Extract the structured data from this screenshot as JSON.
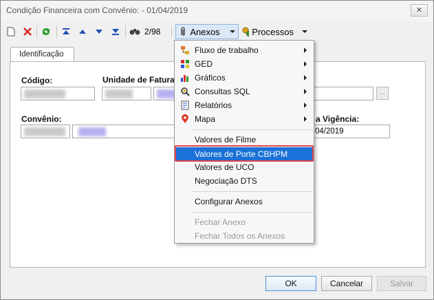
{
  "window": {
    "title": "Condição Financeira com Convênio: - 01/04/2019",
    "close_glyph": "✕"
  },
  "toolbar": {
    "record_counter": "2/98",
    "anexos_label": "Anexos",
    "processos_label": "Processos"
  },
  "tabs": [
    {
      "label": "Identificação"
    }
  ],
  "form": {
    "codigo_label": "Código:",
    "unidade_label": "Unidade de Faturam",
    "convenio_label": "Convênio:",
    "vigencia_label": "a Vigência:",
    "vigencia_value": "04/2019",
    "ellipsis_label": "..."
  },
  "menu": {
    "items": [
      {
        "label": "Fluxo de trabalho",
        "icon": "workflow-icon",
        "submenu": true
      },
      {
        "label": "GED",
        "icon": "ged-icon",
        "submenu": true
      },
      {
        "label": "Gráficos",
        "icon": "chart-icon",
        "submenu": true
      },
      {
        "label": "Consultas SQL",
        "icon": "sql-query-icon",
        "submenu": true
      },
      {
        "label": "Relatórios",
        "icon": "report-icon",
        "submenu": true
      },
      {
        "label": "Mapa",
        "icon": "map-pin-icon",
        "submenu": true
      },
      {
        "label": "Valores de Filme"
      },
      {
        "label": "Valores de Porte CBHPM",
        "selected": true
      },
      {
        "label": "Valores de UCO"
      },
      {
        "label": "Negociação DTS"
      },
      {
        "label": "Configurar Anexos"
      },
      {
        "label": "Fechar Anexo",
        "disabled": true
      },
      {
        "label": "Fechar Todos os Anexos",
        "disabled": true
      }
    ]
  },
  "buttons": {
    "ok": "OK",
    "cancel": "Cancelar",
    "save": "Salvar"
  },
  "colors": {
    "selection": "#1b71d8",
    "highlight_border": "#e0434a"
  }
}
